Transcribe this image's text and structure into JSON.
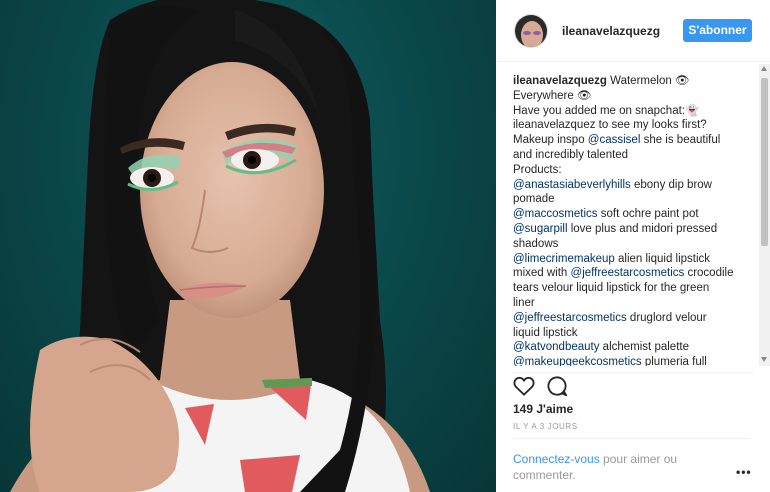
{
  "post": {
    "username": "ileanavelazquezg",
    "follow_label": "S'abonner",
    "caption_lines": [
      [
        {
          "t": "ileanavelazquezg",
          "k": "bold"
        },
        {
          "t": " Watermelon 👁",
          "k": "text"
        }
      ],
      [
        {
          "t": "Everywhere 👁",
          "k": "text"
        }
      ],
      [
        {
          "t": "Have you added me on snapchat:👻",
          "k": "text"
        }
      ],
      [
        {
          "t": "ileanavelazquez to see my looks first?",
          "k": "text"
        }
      ],
      [
        {
          "t": "Makeup inspo ",
          "k": "text"
        },
        {
          "t": "@cassisel",
          "k": "tag"
        },
        {
          "t": " she is beautiful",
          "k": "text"
        }
      ],
      [
        {
          "t": "and incredibly talented",
          "k": "text"
        }
      ],
      [
        {
          "t": "Products:",
          "k": "text"
        }
      ],
      [
        {
          "t": "@anastasiabeverlyhills",
          "k": "tag"
        },
        {
          "t": " ebony dip brow",
          "k": "text"
        }
      ],
      [
        {
          "t": "pomade",
          "k": "text"
        }
      ],
      [
        {
          "t": "@maccosmetics",
          "k": "tag"
        },
        {
          "t": " soft ochre paint pot",
          "k": "text"
        }
      ],
      [
        {
          "t": "@sugarpill",
          "k": "tag"
        },
        {
          "t": " love plus and midori pressed",
          "k": "text"
        }
      ],
      [
        {
          "t": "shadows",
          "k": "text"
        }
      ],
      [
        {
          "t": "@limecrimemakeup",
          "k": "tag"
        },
        {
          "t": " alien liquid lipstick",
          "k": "text"
        }
      ],
      [
        {
          "t": "mixed with ",
          "k": "text"
        },
        {
          "t": "@jeffreestarcosmetics",
          "k": "tag"
        },
        {
          "t": " crocodile",
          "k": "text"
        }
      ],
      [
        {
          "t": "tears velour liquid lipstick for the green",
          "k": "text"
        }
      ],
      [
        {
          "t": "liner",
          "k": "text"
        }
      ],
      [
        {
          "t": "@jeffreestarcosmetics",
          "k": "tag"
        },
        {
          "t": " druglord velour",
          "k": "text"
        }
      ],
      [
        {
          "t": "liquid lipstick",
          "k": "text"
        }
      ],
      [
        {
          "t": "@katvondbeauty",
          "k": "tag"
        },
        {
          "t": " alchemist palette",
          "k": "text"
        }
      ],
      [
        {
          "t": "@makeupgeekcosmetics",
          "k": "tag"
        },
        {
          "t": " plumeria full",
          "k": "text"
        }
      ]
    ],
    "likes_label": "149 J'aime",
    "timestamp": "IL Y A 3 JOURS",
    "login_link": "Connectez-vous",
    "login_rest": " pour aimer ou commenter.",
    "more_label": "•••"
  },
  "icons": {
    "like": "heart-outline-icon",
    "comment": "speech-bubble-icon",
    "more": "ellipsis-icon"
  },
  "colors": {
    "button": "#3897f0",
    "hashtag": "#003569",
    "photo_background": "#0b4a4c"
  }
}
